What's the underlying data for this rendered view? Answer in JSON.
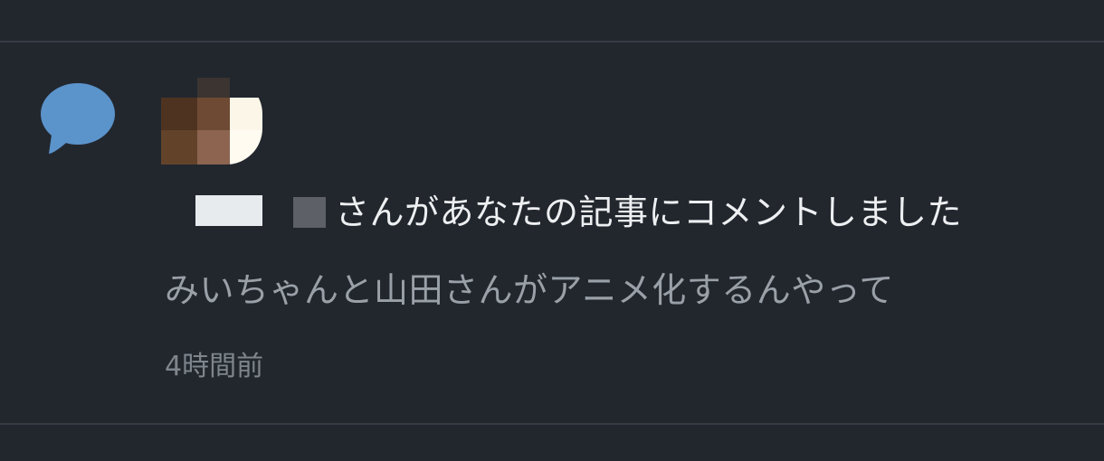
{
  "notification": {
    "type_icon": "speech-bubble-icon",
    "headline": "さんがあなたの記事にコメントしました",
    "comment": "みいちゃんと山田さんがアニメ化するんやって",
    "time": "4時間前"
  },
  "colors": {
    "background": "#22272e",
    "divider": "#363c45",
    "icon_blue": "#5b93cb",
    "headline_text": "#edeff1",
    "comment_text": "#9aa0a8",
    "time_text": "#7f858d"
  }
}
